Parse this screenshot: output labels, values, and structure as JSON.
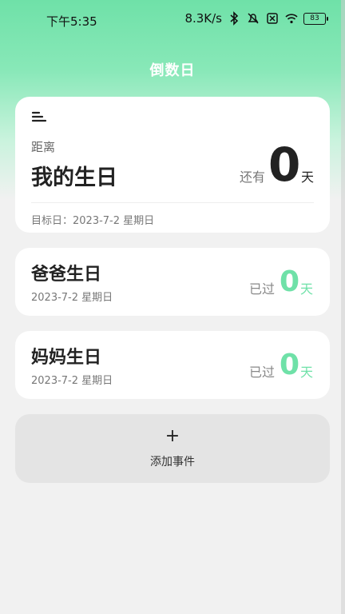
{
  "status_bar": {
    "time": "下午5:35",
    "network_speed": "8.3K/s",
    "battery_level": "83",
    "icons": [
      "bluetooth-icon",
      "mute-icon",
      "sim-icon",
      "wifi-icon",
      "battery-icon"
    ]
  },
  "header": {
    "title": "倒数日"
  },
  "main_event": {
    "distance_label": "距离",
    "name": "我的生日",
    "prefix": "还有",
    "days": "0",
    "unit": "天",
    "target_date": "目标日：2023-7-2 星期日"
  },
  "events": [
    {
      "name": "爸爸生日",
      "date": "2023-7-2 星期日",
      "status": "已过",
      "days": "0",
      "unit": "天"
    },
    {
      "name": "妈妈生日",
      "date": "2023-7-2 星期日",
      "status": "已过",
      "days": "0",
      "unit": "天"
    }
  ],
  "add_button": {
    "icon": "plus-icon",
    "label": "添加事件"
  },
  "colors": {
    "accent": "#6fe1a8",
    "background": "#f1f1f1",
    "card": "#ffffff",
    "add_card": "#e4e4e4"
  }
}
